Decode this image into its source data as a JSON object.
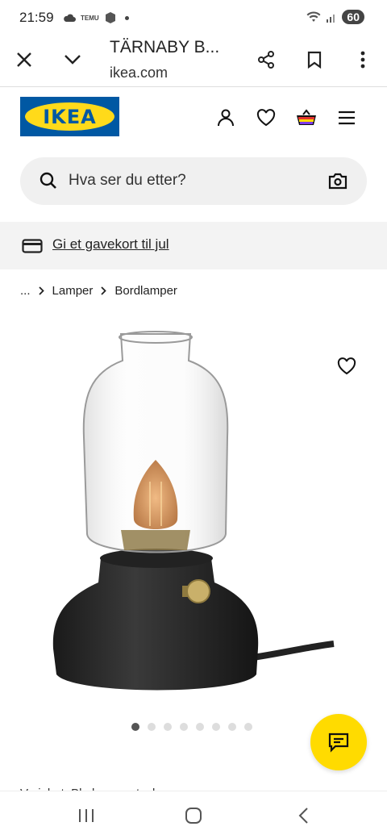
{
  "status": {
    "time": "21:59",
    "temu_label": "TEMU",
    "battery": "60"
  },
  "browser": {
    "title": "TÄRNABY B...",
    "url": "ikea.com"
  },
  "site": {
    "logo_text": "IKEA",
    "brand_blue": "#0058a3",
    "brand_yellow": "#ffda1a"
  },
  "search": {
    "placeholder": "Hva ser du etter?"
  },
  "gift": {
    "text": "Gi et gavekort til jul"
  },
  "breadcrumb": {
    "ellipsis": "...",
    "items": [
      "Lamper",
      "Bordlamper"
    ]
  },
  "gallery": {
    "image_count": 8,
    "active_index": 0
  },
  "peek_text": "Varighet: Bla her og utvalg"
}
